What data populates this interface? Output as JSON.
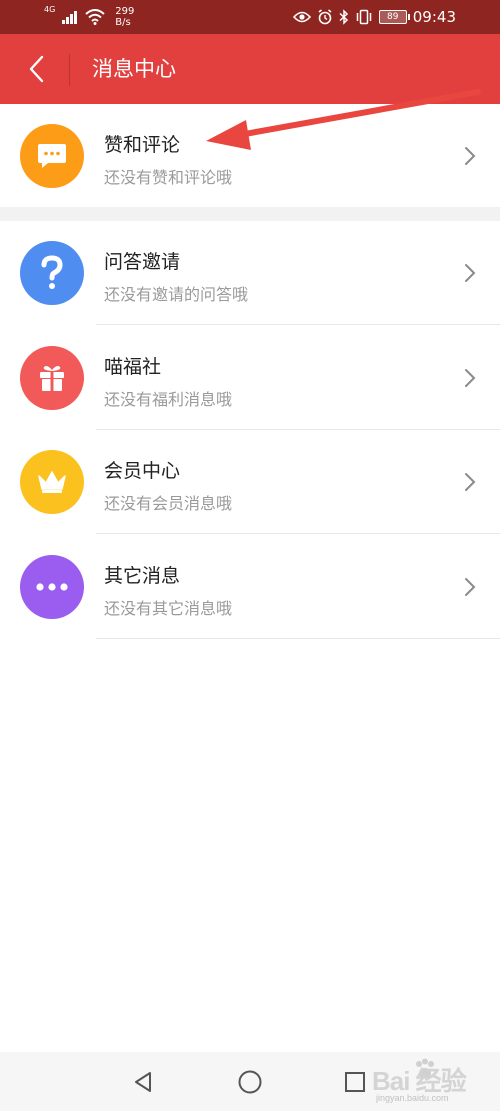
{
  "status_bar": {
    "network": "4G",
    "speed_value": "299",
    "speed_unit": "B/s",
    "battery": "89",
    "time": "09:43"
  },
  "header": {
    "title": "消息中心",
    "back_icon": "chevron-left-icon"
  },
  "items": [
    {
      "title": "赞和评论",
      "subtitle": "还没有赞和评论哦",
      "icon": "comment-bubble-icon",
      "color": "#fd9c16"
    },
    {
      "title": "问答邀请",
      "subtitle": "还没有邀请的问答哦",
      "icon": "question-mark-icon",
      "color": "#4f8ef0"
    },
    {
      "title": "喵福社",
      "subtitle": "还没有福利消息哦",
      "icon": "gift-icon",
      "color": "#f25a5a"
    },
    {
      "title": "会员中心",
      "subtitle": "还没有会员消息哦",
      "icon": "crown-icon",
      "color": "#fbc21f"
    },
    {
      "title": "其它消息",
      "subtitle": "还没有其它消息哦",
      "icon": "more-dots-icon",
      "color": "#9b5cf0"
    }
  ],
  "colors": {
    "header_bg": "#e2403f",
    "status_bar_bg": "#8e2520",
    "annotation_arrow": "#e8463f"
  },
  "nav_bar": {
    "back": "triangle-back-icon",
    "home": "circle-home-icon",
    "recent": "square-recent-icon"
  },
  "watermark": {
    "text": "Bai 经验",
    "sub": "jingyan.baidu.com"
  }
}
